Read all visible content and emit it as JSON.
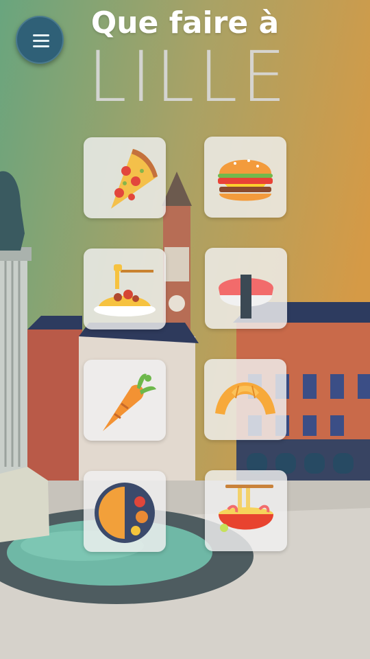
{
  "header": {
    "title": "Que faire à",
    "city": "LILLE"
  },
  "menu": {
    "icon": "hamburger-menu-icon"
  },
  "categories": [
    {
      "icon": "pizza-icon"
    },
    {
      "icon": "burger-icon"
    },
    {
      "icon": "spaghetti-icon"
    },
    {
      "icon": "sushi-icon"
    },
    {
      "icon": "carrot-icon"
    },
    {
      "icon": "croissant-icon"
    },
    {
      "icon": "indian-curry-plate-icon"
    },
    {
      "icon": "ramen-bowl-icon"
    }
  ],
  "colors": {
    "gradient_left": "#6aa57f",
    "gradient_right": "#d29a45",
    "menu_button": "#2f6077"
  }
}
